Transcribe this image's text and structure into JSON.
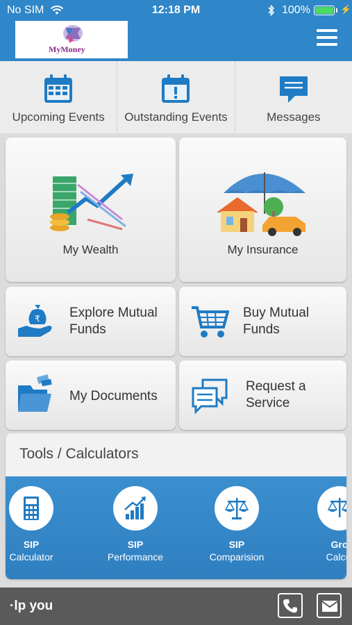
{
  "status_bar": {
    "carrier": "No SIM",
    "time": "12:18 PM",
    "battery": "100%",
    "battery_level": 1.0
  },
  "header": {
    "logo_text": "MyMoney",
    "menu_icon": "hamburger-icon"
  },
  "event_tabs": [
    {
      "label": "Upcoming Events",
      "icon": "calendar-grid-icon"
    },
    {
      "label": "Outstanding Events",
      "icon": "calendar-alert-icon"
    },
    {
      "label": "Messages",
      "icon": "message-icon"
    }
  ],
  "tiles": {
    "my_wealth": "My Wealth",
    "my_insurance": "My Insurance",
    "explore_mutual_funds": [
      "Explore Mutual",
      "Funds"
    ],
    "buy_mutual_funds": [
      "Buy Mutual",
      "Funds"
    ],
    "my_documents": "My Documents",
    "request_service": [
      "Request a",
      "Service"
    ]
  },
  "tools": {
    "title": "Tools / Calculators",
    "items": [
      {
        "line1": "SIP",
        "line2": "Calculator",
        "icon": "calculator-icon"
      },
      {
        "line1": "SIP",
        "line2": "Performance",
        "icon": "growth-chart-icon"
      },
      {
        "line1": "SIP",
        "line2": "Comparision",
        "icon": "balance-scale-icon"
      },
      {
        "line1": "Gro",
        "line2": "Calcul",
        "icon": "balance-scale-icon"
      }
    ]
  },
  "bottom_bar": {
    "text": "·lp you",
    "call_icon": "phone-icon",
    "mail_icon": "envelope-icon"
  },
  "colors": {
    "primary": "#2f86c8",
    "icon_blue": "#1e7bc4",
    "bottom_bar": "#5a5a5a"
  }
}
